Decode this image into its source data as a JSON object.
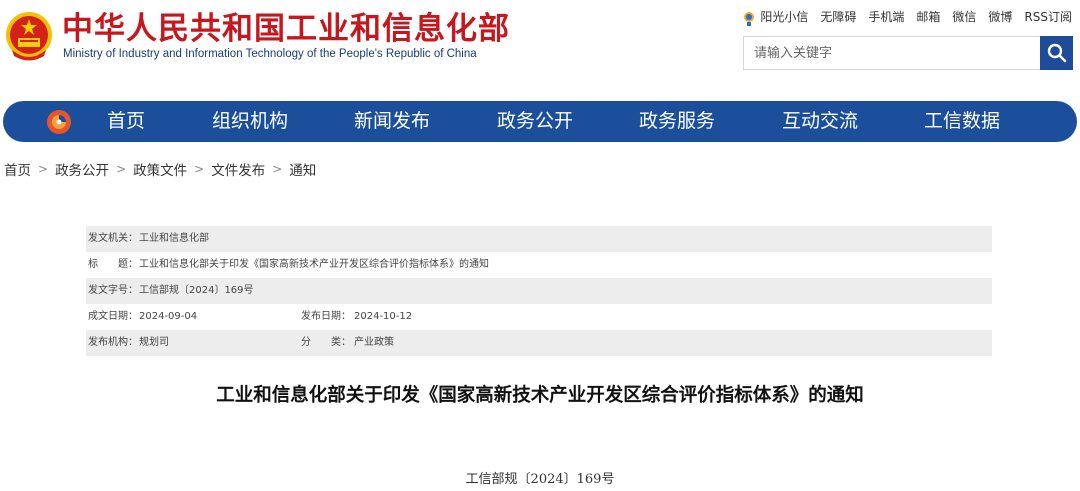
{
  "header": {
    "logo_cn": "中华人民共和国工业和信息化部",
    "logo_en": "Ministry of Industry and Information Technology of the People's Republic of China",
    "top_links": [
      "阳光小信",
      "无障碍",
      "手机端",
      "邮箱",
      "微信",
      "微博",
      "RSS订阅"
    ],
    "search_placeholder": "请输入关键字"
  },
  "nav": {
    "items": [
      "首页",
      "组织机构",
      "新闻发布",
      "政务公开",
      "政务服务",
      "互动交流",
      "工信数据"
    ]
  },
  "breadcrumb": [
    "首页",
    "政务公开",
    "政策文件",
    "文件发布",
    "通知"
  ],
  "meta": {
    "issuer_label": "发文机关：",
    "issuer": "工业和信息化部",
    "title_label": "标　　题：",
    "title": "工业和信息化部关于印发《国家高新技术产业开发区综合评价指标体系》的通知",
    "docno_label": "发文字号：",
    "docno": "工信部规〔2024〕169号",
    "created_label": "成文日期：",
    "created": "2024-09-04",
    "published_label": "发布日期：",
    "published": "2024-10-12",
    "org_label": "发布机构：",
    "org": "规划司",
    "category_label": "分　　类：",
    "category": "产业政策"
  },
  "article": {
    "title": "工业和信息化部关于印发《国家高新技术产业开发区综合评价指标体系》的通知",
    "doc_number": "工信部规〔2024〕169号"
  },
  "colors": {
    "nav_blue": "#1b4f9c",
    "logo_red": "#c8161d",
    "search_btn": "#1e4b9a"
  },
  "icons": {
    "emblem": "national-emblem-icon",
    "sun": "sun-icon",
    "search": "search-icon",
    "nav_logo": "miit-logo-icon"
  }
}
